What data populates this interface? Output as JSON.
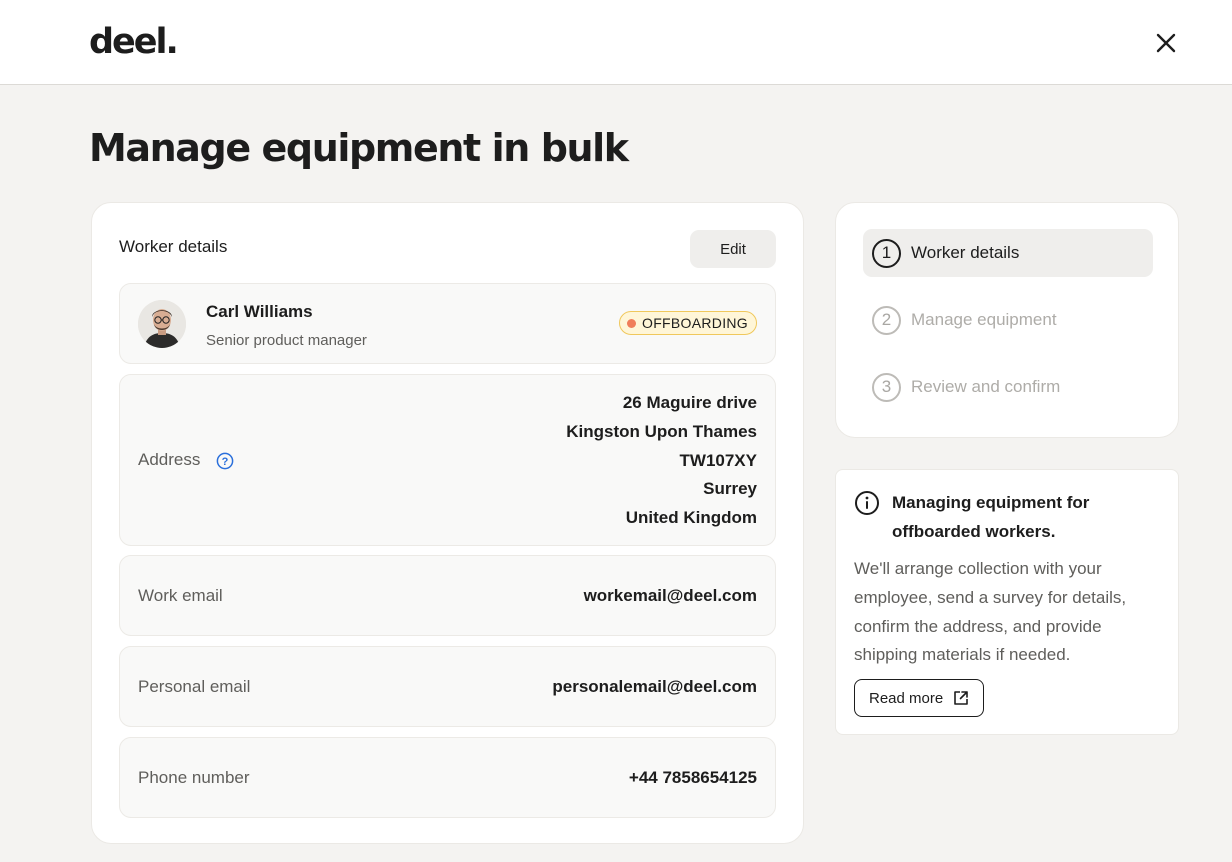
{
  "header": {
    "logo_text": "deel.",
    "close_icon": "close-icon"
  },
  "page": {
    "title": "Manage equipment in bulk"
  },
  "worker_details": {
    "section_title": "Worker details",
    "edit_label": "Edit",
    "worker": {
      "name": "Carl Williams",
      "role": "Senior product manager",
      "status": "OFFBOARDING",
      "status_color": "#f07e5a"
    },
    "address": {
      "label": "Address",
      "lines": [
        "26 Maguire drive",
        "Kingston Upon Thames",
        "TW107XY",
        "Surrey",
        "United Kingdom"
      ]
    },
    "work_email": {
      "label": "Work email",
      "value": "workemail@deel.com"
    },
    "personal_email": {
      "label": "Personal email",
      "value": "personalemail@deel.com"
    },
    "phone": {
      "label": "Phone number",
      "value": "+44 7858654125"
    }
  },
  "steps": [
    {
      "number": "1",
      "label": "Worker details",
      "active": true
    },
    {
      "number": "2",
      "label": "Manage equipment",
      "active": false
    },
    {
      "number": "3",
      "label": "Review and confirm",
      "active": false
    }
  ],
  "info": {
    "title": "Managing equipment for offboarded workers.",
    "body": "We'll arrange collection with your employee, send a survey for details, confirm the address, and provide shipping materials if needed.",
    "read_more_label": "Read more"
  }
}
